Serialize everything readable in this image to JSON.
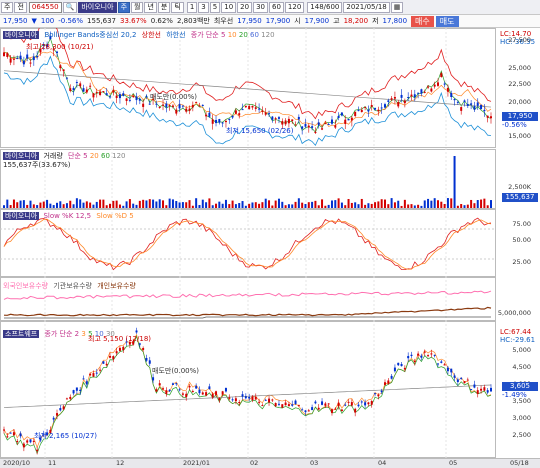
{
  "toolbar": {
    "menu_label": "주",
    "menu_label2": "전",
    "code": "064550",
    "name": "바이오니아",
    "period_buttons": [
      "주",
      "월",
      "년",
      "분",
      "틱"
    ],
    "intervals": [
      "1",
      "3",
      "5",
      "10",
      "20",
      "30",
      "60",
      "120"
    ],
    "count": "148/600",
    "date": "2021/05/18"
  },
  "quote": {
    "price": "17,950",
    "arrow": "▼",
    "change": "100",
    "change_pct": "-0.56%",
    "volume": "155,637",
    "turnover_pct": "33.67%",
    "ratio": "0.62%",
    "amount": "2,803백만",
    "sub_label": "최우선",
    "best_ask": "17,950",
    "best_bid": "17,900",
    "open_label": "시",
    "open": "17,900",
    "high_label": "고",
    "high": "18,200",
    "low_label": "저",
    "low": "17,800",
    "buy_label": "매수",
    "sell_label": "매도"
  },
  "panel1": {
    "legend_name": "바이오니아",
    "legend_bb": "Bollinger Bands중심선 20,2",
    "legend_upper": "상한선",
    "legend_lower": "하한선",
    "legend_ma": "종가 단순",
    "ma_periods": [
      "5",
      "10",
      "20",
      "60",
      "120"
    ],
    "lc": "LC:14.70",
    "hc": "HC:-36.35",
    "high_note": "최고 28,300 (10/21)",
    "low_note": "최저 15,650 (02/26)",
    "ex_note": "매도만(0.00%)",
    "axis": [
      "27,500",
      "25,000",
      "22,500",
      "20,000",
      "17,500",
      "15,000"
    ],
    "last_price": "17,950",
    "last_pct": "-0.56%"
  },
  "panel2": {
    "legend_name": "바이오니아",
    "legend_title": "거래량",
    "legend_ma": "단순",
    "ma_periods": [
      "5",
      "20",
      "60",
      "120"
    ],
    "volume_note": "155,637주(33.67%)",
    "axis": [
      "2,500K",
      "1,250K"
    ],
    "last_value": "155,637"
  },
  "panel3": {
    "legend_name": "바이오니아",
    "legend_title": "Slow %K 12,5",
    "legend_d": "Slow %D 5",
    "axis": [
      "75.00",
      "50.00",
      "25.00"
    ]
  },
  "panel4": {
    "legend_a": "외국인보유수량",
    "legend_b": "기관보유수량",
    "legend_c": "개인보유수량",
    "axis": [
      "5,000,000"
    ]
  },
  "panel5": {
    "legend_name": "소프트웨프",
    "legend_ma": "종가 단순",
    "ma_periods": [
      "2",
      "3",
      "5",
      "10",
      "30"
    ],
    "lc": "LC:67.44",
    "hc": "HC:-29.61",
    "high_note": "최고 5,150 (12/18)",
    "low_note": "최저 2,165 (10/27)",
    "ex_note": "매도만(0.00%)",
    "axis": [
      "5,000",
      "4,500",
      "4,000",
      "3,500",
      "3,000",
      "2,500"
    ],
    "last_price": "3,605",
    "last_pct": "-1.49%"
  },
  "xaxis": [
    "2020/10",
    "11",
    "12",
    "2021/01",
    "02",
    "03",
    "04",
    "05",
    "05/18"
  ],
  "colors": {
    "up": "#d40000",
    "down": "#0030d0",
    "bb": "#d40000",
    "ma5": "#ff8a2a",
    "ma10": "#2aa02a",
    "ma20": "#4a6ad8"
  }
}
